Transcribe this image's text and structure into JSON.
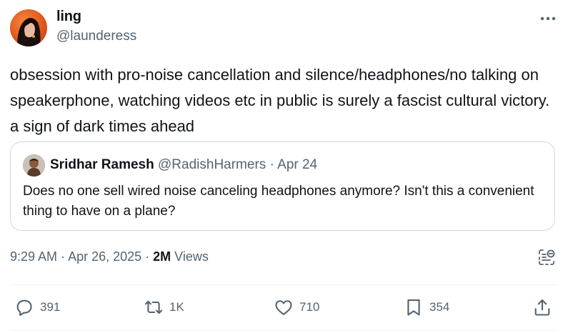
{
  "author": {
    "display_name": "ling",
    "handle": "@launderess"
  },
  "tweet": {
    "text": "obsession with pro-noise cancellation and silence/headphones/no talking on speakerphone, watching videos etc in public is surely a fascist cultural victory. a sign of dark times ahead"
  },
  "quoted": {
    "display_name": "Sridhar Ramesh",
    "handle": "@RadishHarmers",
    "separator": " · ",
    "date": "Apr 24",
    "text": "Does no one sell wired noise canceling headphones anymore? Isn't this a convenient thing to have on a plane?"
  },
  "meta": {
    "time": "9:29 AM",
    "separator1": " · ",
    "date": "Apr 26, 2025",
    "separator2": " · ",
    "views_count": "2M",
    "views_label": " Views"
  },
  "actions": {
    "replies": "391",
    "reposts": "1K",
    "likes": "710",
    "bookmarks": "354"
  },
  "icons": {
    "more": "more-horizontal-icon",
    "grok": "grok-explain-icon",
    "reply": "reply-icon",
    "repost": "repost-icon",
    "like": "heart-icon",
    "bookmark": "bookmark-icon",
    "share": "share-icon"
  },
  "colors": {
    "text_primary": "#0f1419",
    "text_secondary": "#536471",
    "border": "#cfd9de"
  }
}
